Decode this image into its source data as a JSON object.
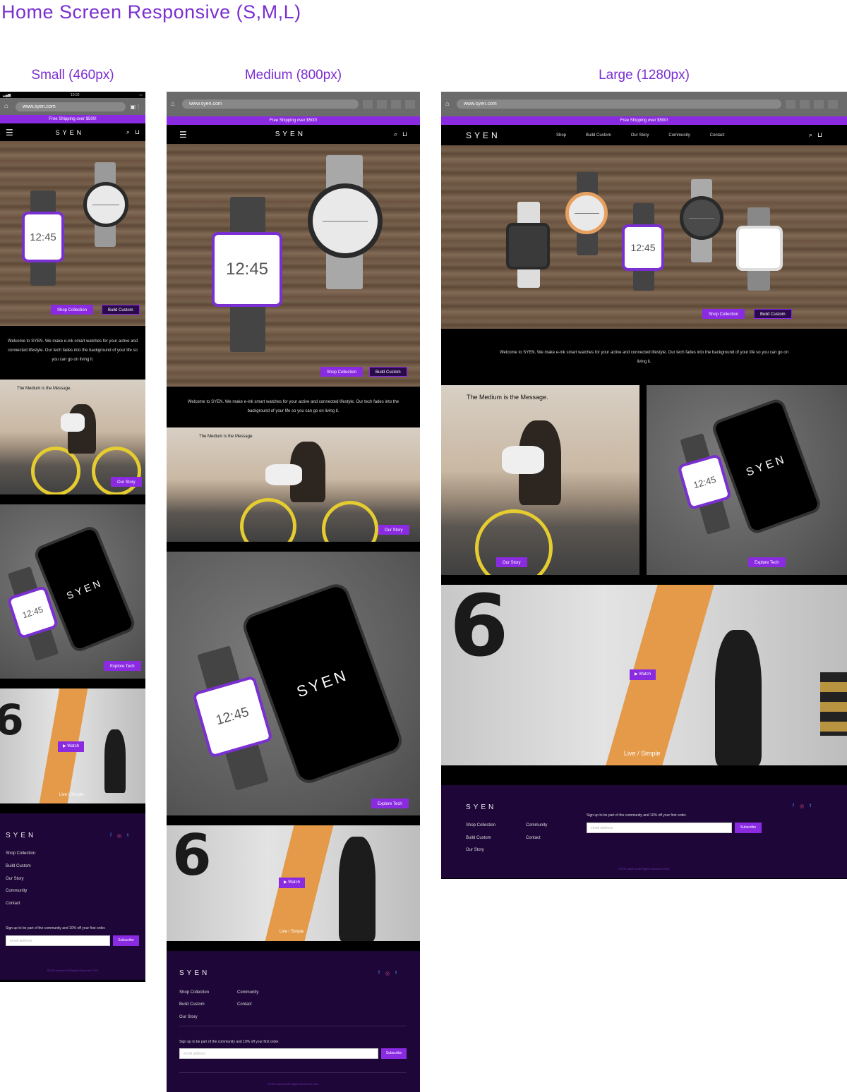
{
  "page_title": "Home Screen Responsive (S,M,L)",
  "columns": {
    "small": "Small (460px)",
    "medium": "Medium (800px)",
    "large": "Large (1280px)"
  },
  "status_bar": {
    "time": "10:02"
  },
  "browser": {
    "url": "www.syen.com"
  },
  "promo": "Free Shipping over $500!",
  "brand": "SYEN",
  "nav": [
    "Shop",
    "Build Custom",
    "Our Story",
    "Community",
    "Contact"
  ],
  "hero": {
    "watch_time": "12:45",
    "shop_button": "Shop Collection",
    "build_button": "Build Custom"
  },
  "welcome": "Welcome to SYEN. We make e-ink smart watches for your active and connected lifestyle. Our tech fades into the background of your life so you can go on living it.",
  "story": {
    "headline": "The Medium is the Message.",
    "button": "Our Story"
  },
  "tech": {
    "watch_time": "12:45",
    "phone_logo": "SYEN",
    "button": "Explore Tech"
  },
  "video": {
    "number": "6",
    "button": "Watch",
    "caption": "Live / Simple"
  },
  "footer": {
    "logo": "SYEN",
    "links": [
      "Shop Collection",
      "Build Custom",
      "Our Story",
      "Community",
      "Contact"
    ],
    "signup": "Sign up to be part of the community and 10% off your first order.",
    "email_placeholder": "email address",
    "subscribe": "Subscribe",
    "copyright": "SYEN watches All Rights Reserved 2021"
  },
  "colors": {
    "accent": "#8a2be2",
    "title": "#7a2fd0",
    "footer_bg": "#1e0738"
  }
}
